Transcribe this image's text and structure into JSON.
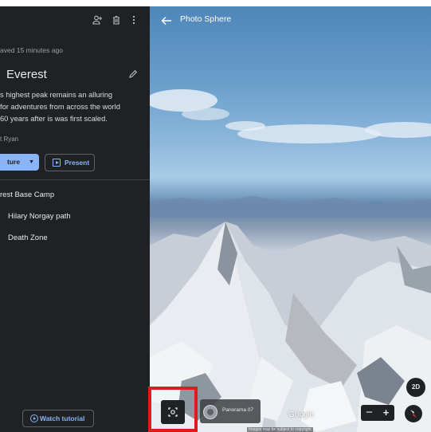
{
  "panel": {
    "saved_text": "aved 15 minutes ago",
    "title": "Everest",
    "description_lines": [
      "s highest peak remains an alluring",
      "for adventures from across the world",
      " 60 years after is was first scaled."
    ],
    "author": "t Ryan",
    "feature_button_label": "ture",
    "present_button_label": "Present",
    "slides": [
      {
        "label": "rest Base Camp"
      },
      {
        "label": "Hilary Norgay path"
      },
      {
        "label": "Death Zone"
      }
    ],
    "tutorial_button_label": "Watch tutorial",
    "icons": {
      "add_person": "add-person-icon",
      "delete": "trash-icon",
      "more": "more-vert-icon",
      "edit": "pencil-icon"
    }
  },
  "view": {
    "title": "Photo Sphere",
    "panorama_label": "Panorama 07",
    "google_label": "Google",
    "btn_2d_label": "2D",
    "zoom_minus": "−",
    "zoom_plus": "+",
    "attribution": "Images may be subject to copyright",
    "icons": {
      "back": "arrow-back-icon",
      "capture": "capture-icon",
      "compass": "compass-icon"
    }
  },
  "colors": {
    "panel_bg": "#202124",
    "accent_blue": "#8ab4f8",
    "highlight": "#e01b1b"
  }
}
